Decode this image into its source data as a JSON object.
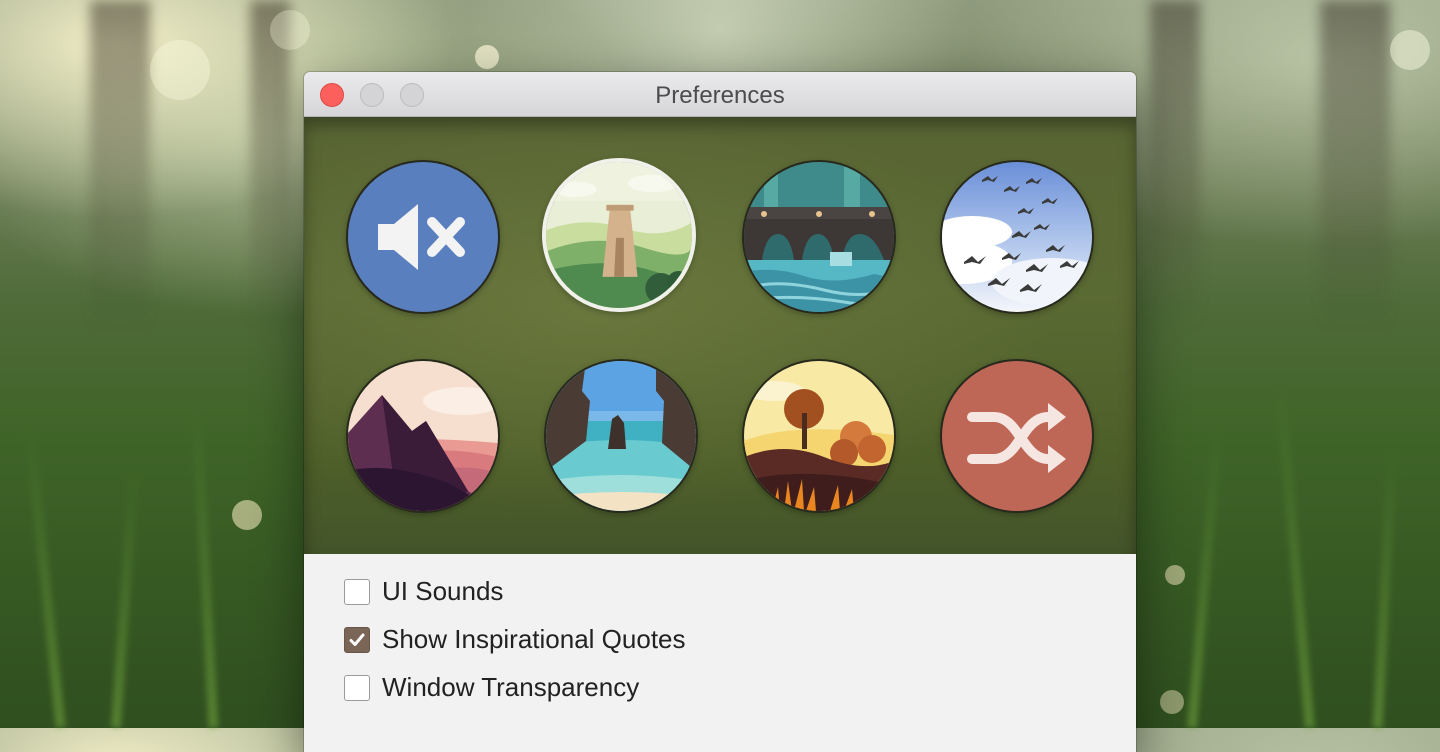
{
  "window": {
    "title": "Preferences",
    "controls": [
      "close-button",
      "minimize-button",
      "zoom-button"
    ]
  },
  "themes": [
    {
      "id": "mute",
      "icon": "speaker-muted-icon",
      "color": "#5a7fbf",
      "selected": false
    },
    {
      "id": "tower-hills",
      "icon": "tower-hills-landscape",
      "selected": true
    },
    {
      "id": "aqueduct",
      "icon": "aqueduct-river-landscape",
      "selected": false
    },
    {
      "id": "birds",
      "icon": "flock-birds-sky",
      "selected": false
    },
    {
      "id": "mountains",
      "icon": "purple-mountains-sunset",
      "selected": false
    },
    {
      "id": "cliffs",
      "icon": "cliffs-lagoon-beach",
      "selected": false
    },
    {
      "id": "autumn",
      "icon": "autumn-tree-forest",
      "selected": false
    },
    {
      "id": "shuffle",
      "icon": "shuffle-icon",
      "color": "#bf6757",
      "selected": false
    }
  ],
  "options": [
    {
      "label": "UI Sounds",
      "checked": false
    },
    {
      "label": "Show Inspirational Quotes",
      "checked": true
    },
    {
      "label": "Window Transparency",
      "checked": false
    }
  ],
  "colors": {
    "checkbox_checked": "#7a6556",
    "close_button": "#fc605c",
    "panel_bg": "#566531"
  }
}
